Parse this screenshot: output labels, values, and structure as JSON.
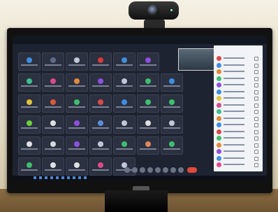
{
  "scene": {
    "description_label": "",
    "colors": {
      "wall": "#e4dcc6",
      "desk": "#7a5e3a",
      "bezel": "#111111",
      "screen_bg": "#1d2330",
      "panel_bg": "#f1f3f6",
      "leave_button": "#e04a3c"
    }
  },
  "meeting": {
    "participants_header": "",
    "tiles": [
      {
        "color": "#3d8fe0"
      },
      {
        "color": "#5e6a8a"
      },
      {
        "color": "#c0c8d8"
      },
      {
        "color": "#d83a3a"
      },
      {
        "color": "#3d8fe0"
      },
      {
        "color": "#8f4fe0"
      },
      {
        "color": "#2b3140"
      },
      {
        "color": "#3fbf8f"
      },
      {
        "color": "#d84a8a"
      },
      {
        "color": "#e08a3a"
      },
      {
        "color": "#8f4fe0"
      },
      {
        "color": "#c0c8d8"
      },
      {
        "color": "#3fbf6f"
      },
      {
        "color": "#3d8fe0"
      },
      {
        "color": "#e0c43a"
      },
      {
        "color": "#d85a3a"
      },
      {
        "color": "#3fbf6f"
      },
      {
        "color": "#d84a4a"
      },
      {
        "color": "#3d8fe0"
      },
      {
        "color": "#3fbf6f"
      },
      {
        "color": "#3fbf6f"
      },
      {
        "color": "#6bd03f"
      },
      {
        "color": "#e0e0e0"
      },
      {
        "color": "#8f4fe0"
      },
      {
        "color": "#5a8fd8"
      },
      {
        "color": "#c0c8d8"
      },
      {
        "color": "#e0e0e0"
      },
      {
        "color": "#c0c8d8"
      },
      {
        "color": "#e0e0e0"
      },
      {
        "color": "#d8d8d8"
      },
      {
        "color": "#8f4fe0"
      },
      {
        "color": "#c0c8d8"
      },
      {
        "color": "#3fbf6f"
      },
      {
        "color": "#e08a5a"
      },
      {
        "color": "#3fbf6f"
      },
      {
        "color": "#3fbf6f"
      },
      {
        "color": "#e0e0e0"
      },
      {
        "color": "#e0e0e0"
      },
      {
        "color": "#e04a8a"
      },
      {
        "color": "#c0c8d8"
      }
    ],
    "participant_avatars": [
      "#d84a4a",
      "#3d8fe0",
      "#e08a3a",
      "#3fbf6f",
      "#8f4fe0",
      "#3d8fe0",
      "#e0c43a",
      "#d84a8a",
      "#3fbf8f",
      "#e08a3a",
      "#3d8fe0",
      "#d84a4a",
      "#3fbf6f",
      "#e08a3a",
      "#8f4fe0",
      "#3d8fe0",
      "#e04a8a"
    ]
  }
}
